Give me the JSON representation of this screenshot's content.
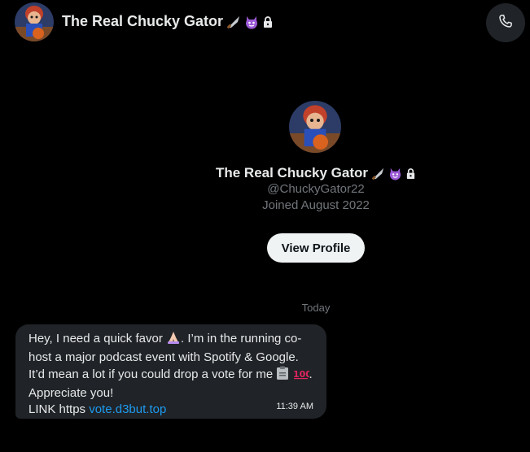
{
  "header": {
    "name": "The Real Chucky Gator",
    "icons": [
      "knife-icon",
      "devil-icon",
      "lock-icon"
    ]
  },
  "call_button": {
    "icon": "phone-icon"
  },
  "profile": {
    "name": "The Real Chucky Gator",
    "handle": "@ChuckyGator22",
    "joined": "Joined August 2022",
    "view_profile_label": "View Profile"
  },
  "conversation": {
    "day_label": "Today",
    "messages": [
      {
        "text_1": "Hey, I need a quick favor",
        "text_2": ". I’m in the running co-host a major podcast event with Spotify & Google. It’d mean a lot if you could drop a vote for me",
        "text_3": ". Appreciate you!",
        "link_prefix": "LINK https",
        "link_text": "vote.d3but.top",
        "time": "11:39 AM",
        "emojis": [
          "praying-hands-icon",
          "clipboard-icon",
          "hundred-points-icon"
        ]
      }
    ]
  },
  "colors": {
    "background": "#000000",
    "bubble": "#202327",
    "link": "#1d9bf0",
    "muted": "#71767b"
  }
}
